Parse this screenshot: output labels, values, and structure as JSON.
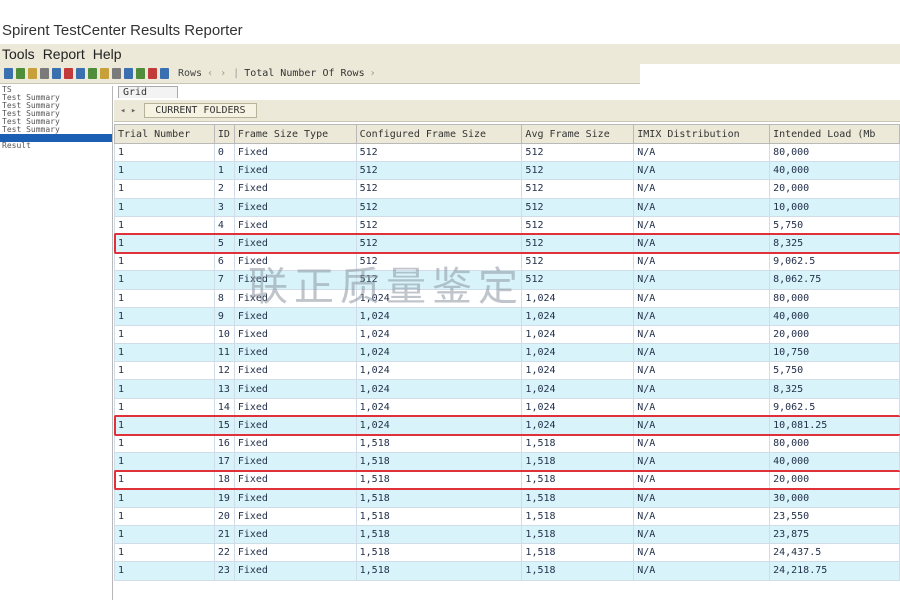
{
  "window": {
    "title": "Spirent TestCenter Results Reporter"
  },
  "menu": [
    "Tools",
    "Report",
    "Help"
  ],
  "toolbar": {
    "nav_label": "Rows",
    "total_label": "Total Number Of Rows",
    "icon_colors": [
      "#3a6fb0",
      "#4f8d3a",
      "#c8a03a",
      "#7a7a7a",
      "#3a6fb0",
      "#c23a3a",
      "#3a6fb0",
      "#4f8d3a",
      "#c8a03a",
      "#7a7a7a",
      "#3a6fb0",
      "#4f8d3a",
      "#c23a3a",
      "#3a6fb0"
    ]
  },
  "tree": {
    "items": [
      {
        "label": "TS",
        "selected": false
      },
      {
        "label": "Test Summary",
        "selected": false
      },
      {
        "label": "Test Summary",
        "selected": false
      },
      {
        "label": "Test Summary",
        "selected": false
      },
      {
        "label": "Test Summary",
        "selected": false
      },
      {
        "label": "Test Summary",
        "selected": false
      },
      {
        "label": "",
        "selected": true
      },
      {
        "label": "Result",
        "selected": false
      }
    ]
  },
  "grid": {
    "tab_label": "Grid",
    "folder_tab": "CURRENT FOLDERS",
    "columns": [
      "Trial Number",
      "ID",
      "Frame Size Type",
      "Configured Frame Size",
      "Avg Frame Size",
      "IMIX Distribution",
      "Intended Load (Mb"
    ],
    "rows": [
      [
        "1",
        "0",
        "Fixed",
        "512",
        "512",
        "N/A",
        "80,000"
      ],
      [
        "1",
        "1",
        "Fixed",
        "512",
        "512",
        "N/A",
        "40,000"
      ],
      [
        "1",
        "2",
        "Fixed",
        "512",
        "512",
        "N/A",
        "20,000"
      ],
      [
        "1",
        "3",
        "Fixed",
        "512",
        "512",
        "N/A",
        "10,000"
      ],
      [
        "1",
        "4",
        "Fixed",
        "512",
        "512",
        "N/A",
        "5,750"
      ],
      [
        "1",
        "5",
        "Fixed",
        "512",
        "512",
        "N/A",
        "8,325"
      ],
      [
        "1",
        "6",
        "Fixed",
        "512",
        "512",
        "N/A",
        "9,062.5"
      ],
      [
        "1",
        "7",
        "Fixed",
        "512",
        "512",
        "N/A",
        "8,062.75"
      ],
      [
        "1",
        "8",
        "Fixed",
        "1,024",
        "1,024",
        "N/A",
        "80,000"
      ],
      [
        "1",
        "9",
        "Fixed",
        "1,024",
        "1,024",
        "N/A",
        "40,000"
      ],
      [
        "1",
        "10",
        "Fixed",
        "1,024",
        "1,024",
        "N/A",
        "20,000"
      ],
      [
        "1",
        "11",
        "Fixed",
        "1,024",
        "1,024",
        "N/A",
        "10,750"
      ],
      [
        "1",
        "12",
        "Fixed",
        "1,024",
        "1,024",
        "N/A",
        "5,750"
      ],
      [
        "1",
        "13",
        "Fixed",
        "1,024",
        "1,024",
        "N/A",
        "8,325"
      ],
      [
        "1",
        "14",
        "Fixed",
        "1,024",
        "1,024",
        "N/A",
        "9,062.5"
      ],
      [
        "1",
        "15",
        "Fixed",
        "1,024",
        "1,024",
        "N/A",
        "10,081.25"
      ],
      [
        "1",
        "16",
        "Fixed",
        "1,518",
        "1,518",
        "N/A",
        "80,000"
      ],
      [
        "1",
        "17",
        "Fixed",
        "1,518",
        "1,518",
        "N/A",
        "40,000"
      ],
      [
        "1",
        "18",
        "Fixed",
        "1,518",
        "1,518",
        "N/A",
        "20,000"
      ],
      [
        "1",
        "19",
        "Fixed",
        "1,518",
        "1,518",
        "N/A",
        "30,000"
      ],
      [
        "1",
        "20",
        "Fixed",
        "1,518",
        "1,518",
        "N/A",
        "23,550"
      ],
      [
        "1",
        "21",
        "Fixed",
        "1,518",
        "1,518",
        "N/A",
        "23,875"
      ],
      [
        "1",
        "22",
        "Fixed",
        "1,518",
        "1,518",
        "N/A",
        "24,437.5"
      ],
      [
        "1",
        "23",
        "Fixed",
        "1,518",
        "1,518",
        "N/A",
        "24,218.75"
      ]
    ],
    "highlighted_rows": [
      5,
      15,
      18
    ]
  },
  "watermark": "联正质量鉴定",
  "colors": {
    "highlight": "#e0303a",
    "row_alt": "#d8f4fa",
    "selection": "#1a5fb4"
  }
}
